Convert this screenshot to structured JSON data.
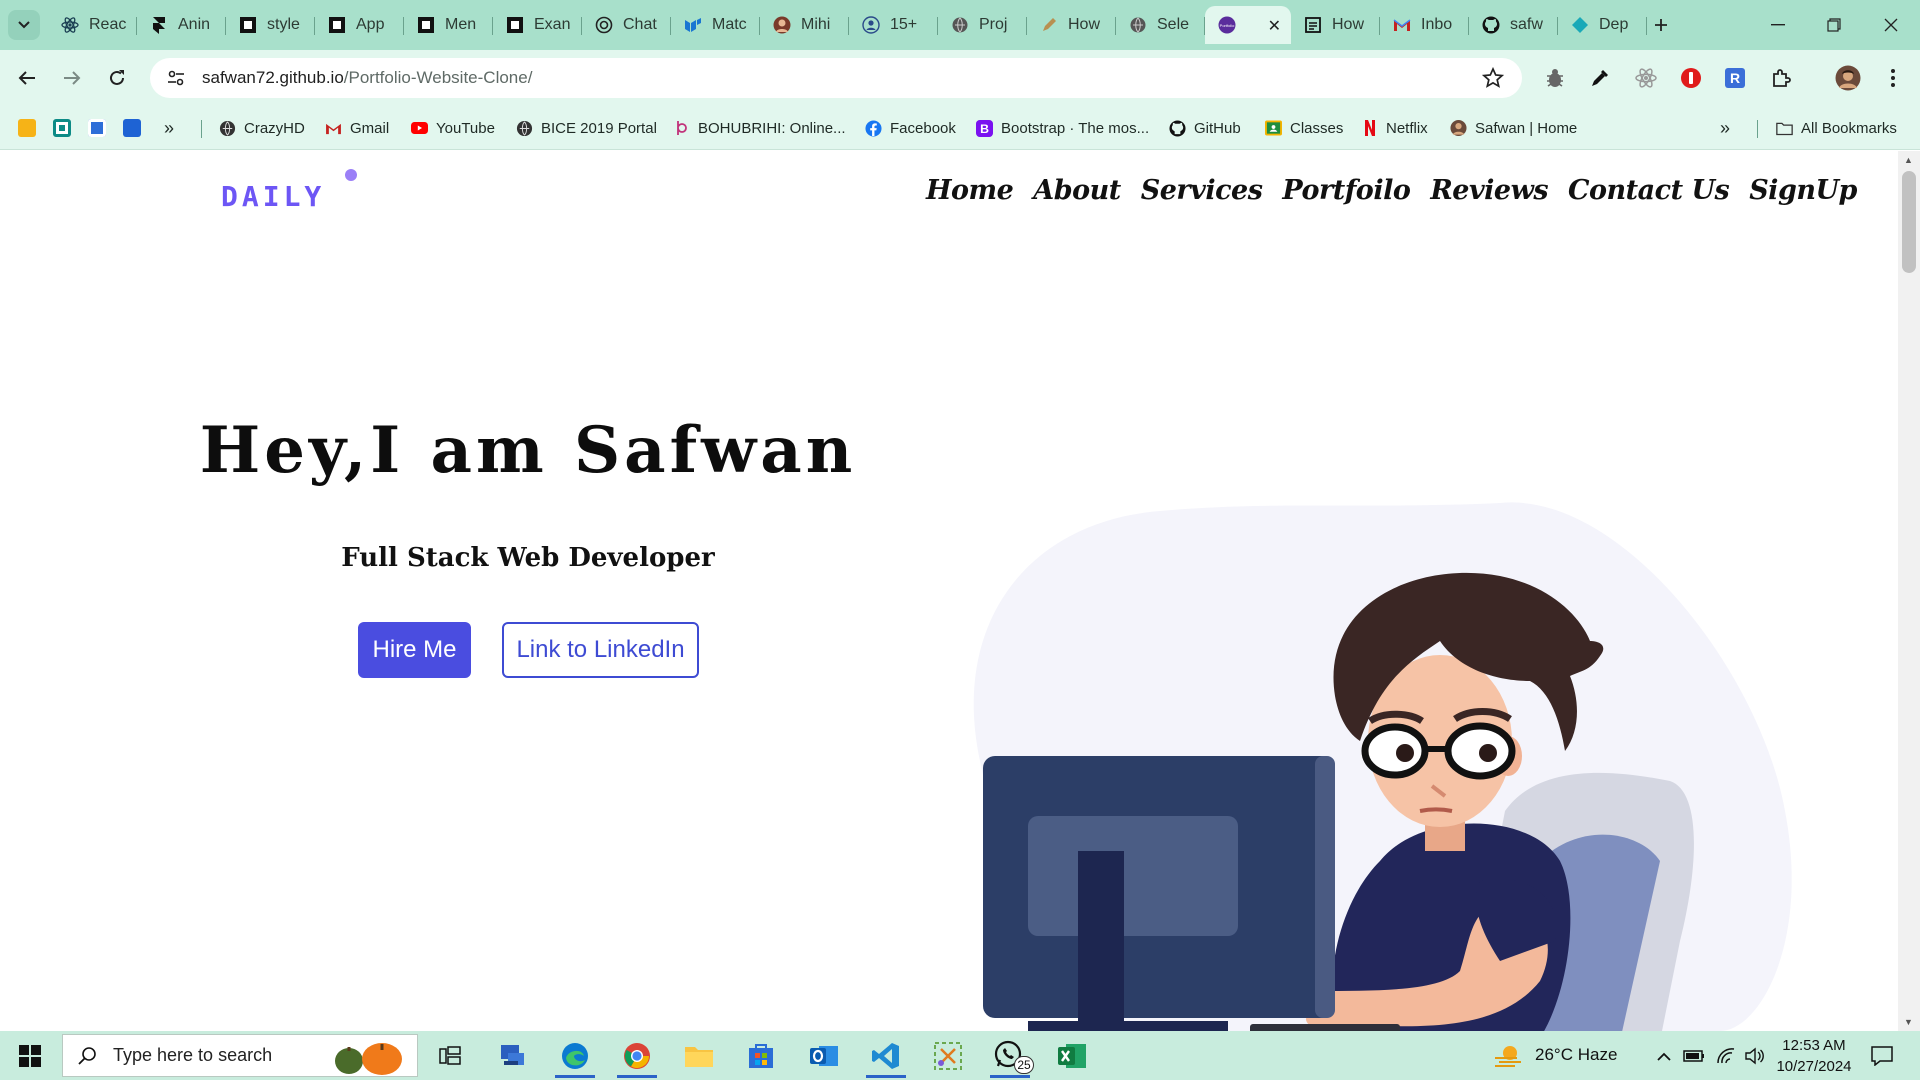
{
  "browser": {
    "tabs": [
      {
        "title": "Reac",
        "icon": "react-icon"
      },
      {
        "title": "Anin",
        "icon": "framer-icon"
      },
      {
        "title": "style",
        "icon": "codepen-icon"
      },
      {
        "title": "App",
        "icon": "codepen-icon"
      },
      {
        "title": "Men",
        "icon": "codepen-icon"
      },
      {
        "title": "Exan",
        "icon": "codepen-icon"
      },
      {
        "title": "Chat",
        "icon": "chatgpt-icon"
      },
      {
        "title": "Matc",
        "icon": "mui-icon"
      },
      {
        "title": "Mihi",
        "icon": "avatar-icon"
      },
      {
        "title": "15+",
        "icon": "person-icon"
      },
      {
        "title": "Proj",
        "icon": "globe-icon"
      },
      {
        "title": "How",
        "icon": "pen-icon"
      },
      {
        "title": "Sele",
        "icon": "globe-icon"
      },
      {
        "title": "",
        "icon": "portfolio-icon",
        "active": true
      },
      {
        "title": "How",
        "icon": "document-icon"
      },
      {
        "title": "Inbo",
        "icon": "gmail-icon"
      },
      {
        "title": "safw",
        "icon": "github-icon"
      },
      {
        "title": "Dep",
        "icon": "diamond-icon"
      }
    ],
    "url_host": "safwan72.github.io",
    "url_path": "/Portfolio-Website-Clone/",
    "bookmarks": [
      {
        "label": "CrazyHD",
        "icon": "globe-icon"
      },
      {
        "label": "Gmail",
        "icon": "gmail-icon"
      },
      {
        "label": "YouTube",
        "icon": "youtube-icon"
      },
      {
        "label": "BICE 2019 Portal",
        "icon": "globe-icon"
      },
      {
        "label": "BOHUBRIHI: Online...",
        "icon": "bohubrihi-icon"
      },
      {
        "label": "Facebook",
        "icon": "facebook-icon"
      },
      {
        "label": "Bootstrap · The mos...",
        "icon": "bootstrap-icon"
      },
      {
        "label": "GitHub",
        "icon": "github-icon"
      },
      {
        "label": "Classes",
        "icon": "classroom-icon"
      },
      {
        "label": "Netflix",
        "icon": "netflix-icon"
      },
      {
        "label": "Safwan | Home",
        "icon": "avatar-icon"
      }
    ],
    "all_bookmarks_label": "All Bookmarks"
  },
  "site": {
    "logo": "DAILY",
    "nav": [
      "Home",
      "About",
      "Services",
      "Portfoilo",
      "Reviews",
      "Contact Us",
      "SignUp"
    ],
    "hero_title": "Hey,I am Safwan",
    "hero_subtitle": "Full Stack Web Developer",
    "hire_button": "Hire Me",
    "linkedin_button": "Link to LinkedIn"
  },
  "taskbar": {
    "search_placeholder": "Type here to search",
    "whatsapp_badge": "25",
    "weather": "26°C  Haze",
    "time": "12:53 AM",
    "date": "10/27/2024"
  },
  "colors": {
    "accent": "#4a4de0",
    "logo": "#6d56f5",
    "browser_frame": "#a8e0cb",
    "toolbar": "#e2f7ee"
  }
}
